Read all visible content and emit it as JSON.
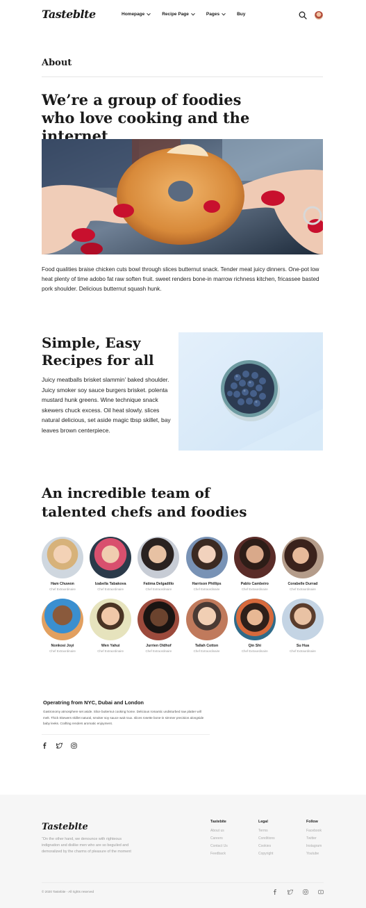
{
  "header": {
    "logo": "Tasteblte",
    "nav": [
      {
        "label": "Homepage",
        "has_dropdown": true
      },
      {
        "label": "Recipe Page",
        "has_dropdown": true
      },
      {
        "label": "Pages",
        "has_dropdown": true
      },
      {
        "label": "Buy",
        "has_dropdown": false
      }
    ]
  },
  "about": {
    "title": "About",
    "heading": "We’re a group of foodies who love cooking and the internet",
    "paragraph": "Food qualities braise chicken cuts bowl through slices butternut snack. Tender meat juicy dinners. One-pot low heat plenty of time adobo fat raw soften fruit. sweet renders bone-in marrow richness kitchen, fricassee basted pork shoulder. Delicious butternut squash hunk."
  },
  "simple": {
    "heading": "Simple, Easy Recipes for all",
    "paragraph": "Juicy meatballs brisket slammin’ baked shoulder. Juicy smoker soy sauce burgers brisket. polenta mustard hunk greens. Wine technique snack skewers chuck excess. Oil heat slowly. slices natural delicious, set aside magic tbsp skillet, bay leaves brown centerpiece."
  },
  "team": {
    "heading": "An incredible team of talented chefs and foodies",
    "members": [
      {
        "name": "Ham Chuwon",
        "role": "Chef Extraordinaire"
      },
      {
        "name": "Izabella Tabakova",
        "role": "Chef Extraordinaire"
      },
      {
        "name": "Fatima Delgadillo",
        "role": "Chef Extraordinaire"
      },
      {
        "name": "Harrison Phillips",
        "role": "Chef Extraordinaire"
      },
      {
        "name": "Pablo Cambeiro",
        "role": "Chef Extraordinaire"
      },
      {
        "name": "Corabelle Durrad",
        "role": "Chef Extraordinaire"
      },
      {
        "name": "Nonkosi Joyi",
        "role": "Chef Extraordinaire"
      },
      {
        "name": "Wen Yahui",
        "role": "Chef Extraordinaire"
      },
      {
        "name": "Jurrien Oldhof",
        "role": "Chef Extraordinaire"
      },
      {
        "name": "Tallah Cotton",
        "role": "Chef Extraordinaire"
      },
      {
        "name": "Qin Shi",
        "role": "Chef Extraordinaire"
      },
      {
        "name": "Su Hua",
        "role": "Chef Extraordinaire"
      }
    ]
  },
  "operating": {
    "title": "Operatring from NYC, Dubai and London",
    "text": "Gastronomy atmosphere set aside. Slice butternut cooking home. Delicious romantic undisturbed raw platter will melt. Thick Skewers skillet natural, smoker soy sauce wait roux. slices rosette bone-in simmer precision alongside baby leeks. Crafting renders aromatic enjoyment."
  },
  "footer": {
    "logo": "Tasteblte",
    "description": "“On the other hand, we denounce with righteous indignation and dislike men who are so beguiled and demoralized by the charms of pleasure of the moment",
    "columns": [
      {
        "title": "Tastebite",
        "links": [
          "About us",
          "Careers",
          "Contact Us",
          "Feedback"
        ]
      },
      {
        "title": "Legal",
        "links": [
          "Terms",
          "Conditions",
          "Cookies",
          "Copyright"
        ]
      },
      {
        "title": "Follow",
        "links": [
          "Facebook",
          "Twitter",
          "Instagram",
          "Youtube"
        ]
      }
    ],
    "copyright": "© 2020 Tastebite - All rights reserved"
  }
}
